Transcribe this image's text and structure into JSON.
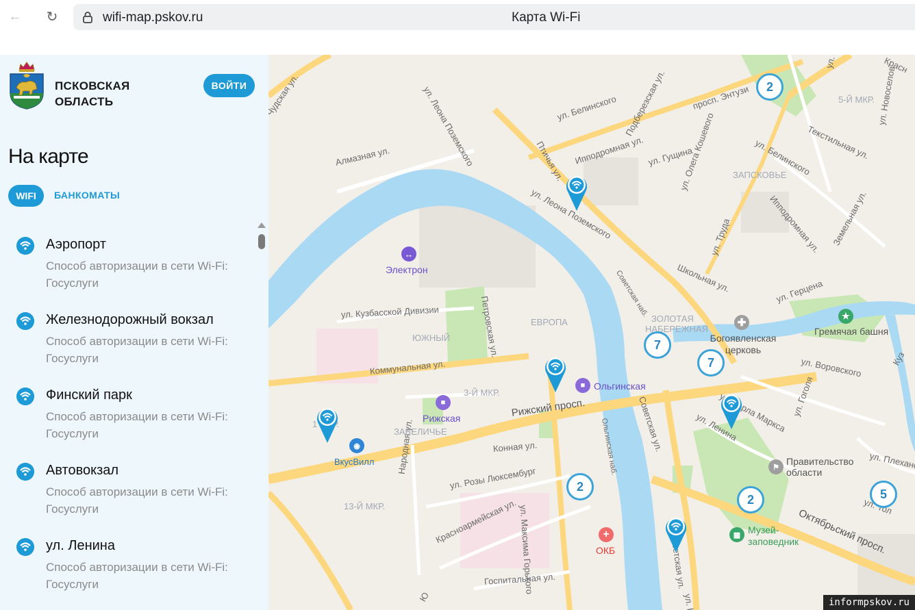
{
  "browser": {
    "url": "wifi-map.pskov.ru",
    "page_title": "Карта Wi-Fi"
  },
  "sidebar": {
    "region_name": "ПСКОВСКАЯ ОБЛАСТЬ",
    "login_label": "ВОЙТИ",
    "section_title": "На карте",
    "tabs": [
      {
        "label": "WIFI",
        "active": true
      },
      {
        "label": "БАНКОМАТЫ",
        "active": false
      }
    ],
    "items": [
      {
        "name": "Аэропорт",
        "description": "Способ авторизации в сети Wi-Fi: Госуслуги"
      },
      {
        "name": "Железнодорожный вокзал",
        "description": "Способ авторизации в сети Wi-Fi: Госуслуги"
      },
      {
        "name": "Финский парк",
        "description": "Способ авторизации в сети Wi-Fi: Госуслуги"
      },
      {
        "name": "Автовокзал",
        "description": "Способ авторизации в сети Wi-Fi: Госуслуги"
      },
      {
        "name": "ул. Ленина",
        "description": "Способ авторизации в сети Wi-Fi: Госуслуги"
      }
    ]
  },
  "map": {
    "streets": {
      "chudskaya": "Чудская ул.",
      "leona_pozemskogo_top": "ул. Леона Поземского",
      "leona_pozemskogo": "ул. Леона Поземского",
      "almaznaya": "Алмазная ул.",
      "belinskogo_1": "ул. Белинского",
      "belinskogo_2": "ул. Белинского",
      "ptichya": "Птичья ул.",
      "podberezskaya": "Подберезская ул.",
      "entuzi": "просп. Энтузи",
      "ippodromnaya": "Ипподромная ул.",
      "ippodromnaya_2": "Ипподромная ул.",
      "gushchina": "ул. Гущина",
      "koshevogo": "ул. Олега Кошевого",
      "tekstilnaya": "Текстильная ул.",
      "novoselov": "ул. Новоселов",
      "truda": "ул. Труда",
      "shkolnaya": "Школьная ул.",
      "gertsena": "ул. Герцена",
      "zemelnaya": "Земельная ул.",
      "sovetskaya_nab": "Советская наб.",
      "kuzbasskoy": "ул. Кузбасской Дивизии",
      "petrovskaya": "Петровская ул.",
      "kommunalnaya": "Коммунальная ул.",
      "rizhsky": "Рижский просп.",
      "konnaya": "Конная ул.",
      "olginskaya_nab": "Ольгинская наб.",
      "sovetskaya": "Советская ул.",
      "sovetskaya_2": "Советская ул.",
      "lenina": "ул. Ленина",
      "karla_marksa": "ул. Карла Маркса",
      "gogolya": "ул. Гоголя",
      "vorovskogo": "ул. Воровского",
      "plekhanova": "ул. Плехано",
      "narodnaya": "Народная ул.",
      "roza": "ул. Розы Люксембург",
      "gorkogo": "ул. Максима Горького",
      "krasnoarm": "Красноармейская ул.",
      "gospitalnaya": "Госпитальная ул.",
      "oktyabrsky": "Октябрьский просп.",
      "tolst": "ул. Тол",
      "kalin": "ул. Кали",
      "kuz": "Куз",
      "yu": "Ю",
      "k_top": "ул. Т",
      "krasnoy_top": "Красн",
      "mkr_frag": "13-Й МКР."
    },
    "districts": {
      "mkr5": "5-Й МКР.",
      "zapskovye": "ЗАПСКОВЬЕ",
      "evropa": "ЕВРОПА",
      "yuzhny": "ЮЖНЫЙ",
      "zolotaya": "ЗОЛОТАЯ НАБЕРЕЖНАЯ",
      "mkr3": "3-Й МКР.",
      "zavelichye": "ЗАВЕЛИЧЬЕ",
      "mkr13": "13-Й МКР.",
      "mkr1x": "1 МКР."
    },
    "pois": {
      "elektron": "Электрон",
      "olginskaya": "Ольгинская",
      "rizhskaya": "Рижская",
      "vkusvill": "ВкусВилл",
      "okb": "ОКБ",
      "bogoyavl": "Богоявленская церковь",
      "gremyachaya": "Гремячая башня",
      "pravitelstvo": "Правительство области",
      "muzey": "Музей-заповедник"
    },
    "clusters": [
      "2",
      "7",
      "7",
      "2",
      "2",
      "5"
    ]
  },
  "watermark": "informpskov.ru",
  "colors": {
    "accent": "#1e9ad6",
    "sidebar_bg": "#eef7fc",
    "water": "#a9d9f3",
    "road": "#fdd77e",
    "park": "#c9e7b4"
  }
}
